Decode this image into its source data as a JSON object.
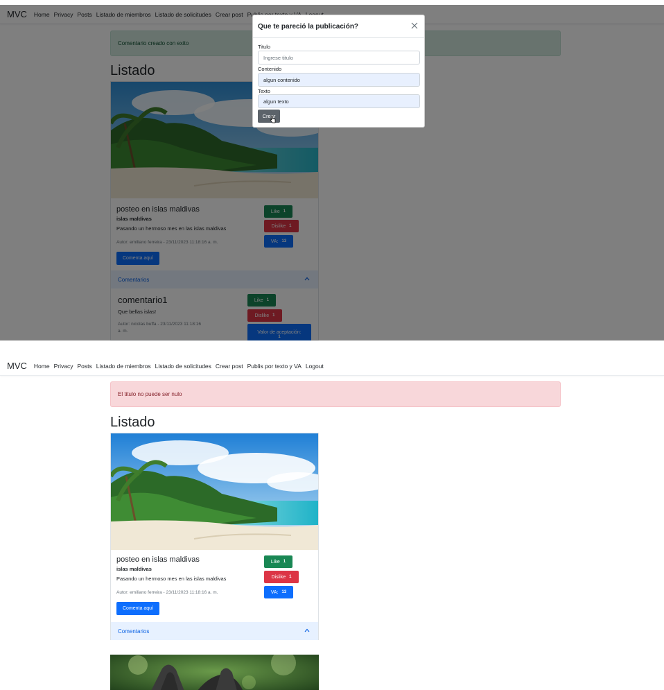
{
  "nav": {
    "brand": "MVC",
    "items": [
      "Home",
      "Privacy",
      "Posts",
      "Listado de miembros",
      "Listado de solicitudes",
      "Crear post",
      "Publis por texto y VA",
      "Logout"
    ]
  },
  "screenshot1": {
    "alert": "Comentario creado con exito",
    "heading": "Listado",
    "post": {
      "title": "posteo en islas maldivas",
      "subtitle": "islas maldivas",
      "text": "Pasando un hermoso mes en las islas maldivas",
      "meta": "Autor: emiliano ferreira - 23/11/2023 11:18:16 a. m.",
      "comment_button": "Comenta aquí",
      "like": {
        "label": "Like",
        "count": "1"
      },
      "dislike": {
        "label": "Dislike",
        "count": "1"
      },
      "va": {
        "label": "VA:",
        "count": "13"
      }
    },
    "accordion_label": "Comentarios",
    "comment": {
      "title": "comentario1",
      "text": "Que bellas islas!",
      "meta_line1": "Autor: nicolas buffa - 23/11/2023 11:18:16",
      "meta_line2": "a. m.",
      "like": {
        "label": "Like",
        "count": "1"
      },
      "dislike": {
        "label": "Dislike",
        "count": "1"
      },
      "acceptance": {
        "label": "Valor de aceptación:",
        "count": "1"
      }
    },
    "modal": {
      "title": "Que te pareció la publicación?",
      "fields": {
        "titulo": {
          "label": "Titulo",
          "value": "",
          "placeholder": "Ingrese titulo"
        },
        "contenido": {
          "label": "Contenido",
          "value": "algun contenido"
        },
        "texto": {
          "label": "Texto",
          "value": "algun texto"
        }
      },
      "submit": "Crear"
    }
  },
  "screenshot2": {
    "alert": "El titulo no puede ser nulo",
    "heading": "Listado",
    "post": {
      "title": "posteo en islas maldivas",
      "subtitle": "islas maldivas",
      "text": "Pasando un hermoso mes en las islas maldivas",
      "meta": "Autor: emiliano ferreira - 23/11/2023 11:18:16 a. m.",
      "comment_button": "Comenta aquí",
      "like": {
        "label": "Like",
        "count": "1"
      },
      "dislike": {
        "label": "Dislike",
        "count": "1"
      },
      "va": {
        "label": "VA:",
        "count": "13"
      }
    },
    "accordion_label": "Comentarios"
  },
  "colors": {
    "primary": "#0d6efd",
    "success": "#198754",
    "danger": "#dc3545",
    "secondary": "#5c636a",
    "alert_success_bg": "#d1e7dd",
    "alert_danger_bg": "#f8d7da"
  }
}
